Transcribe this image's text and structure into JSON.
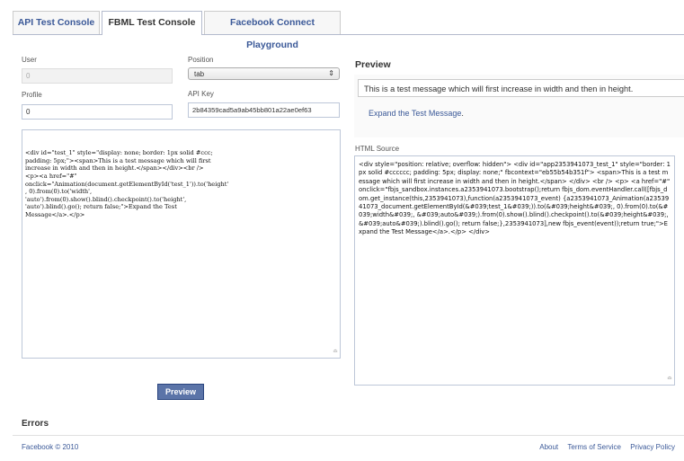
{
  "tabs": [
    {
      "label": "API Test Console"
    },
    {
      "label": "FBML Test Console"
    },
    {
      "label": "Facebook Connect Playground"
    }
  ],
  "form": {
    "user_label": "User",
    "user_value": "0",
    "position_label": "Position",
    "position_value": "tab",
    "profile_label": "Profile",
    "profile_value": "0",
    "api_key_label": "API Key",
    "api_key_value": "2b84359cad5a9ab45bb801a22ae0ef63"
  },
  "fbml_code": "<div id=\"test_1\" style=\"display: none; border: 1px solid #ccc;\npadding: 5px;\"><span>This is a test message which will first\nincrease in width and then in height.</span></div><br />\n<p><a href=\"#\"\nonclick=\"Animation(document.getElementById('test_1')).to('height'\n, 0).from(0).to('width',\n'auto').from(0).show().blind().checkpoint().to('height',\n'auto').blind().go(); return false;\">Expand the Test\nMessage</a>.</p>",
  "preview": {
    "title": "Preview",
    "message": "This is a test message which will first increase in width and then in height.",
    "link": "Expand the Test Message",
    "link_suffix": "."
  },
  "html_source": {
    "label": "HTML Source",
    "text": "<div style=\"position: relative; overflow: hidden\"> <div id=\"app2353941073_test_1\" style=\"border: 1px solid #cccccc; padding: 5px; display: none;\" fbcontext=\"eb55b54b351f\"> <span>This is a test message which will first increase in width and then in height.</span> </div> <br /> <p> <a href=\"#\" onclick=\"fbjs_sandbox.instances.a2353941073.bootstrap();return fbjs_dom.eventHandler.call([fbjs_dom.get_instance(this,2353941073),function(a2353941073_event) {a2353941073_Animation(a2353941073_document.getElementById(&#039;test_1&#039;)).to(&#039;height&#039;, 0).from(0).to(&#039;width&#039;, &#039;auto&#039;).from(0).show().blind().checkpoint().to(&#039;height&#039;, &#039;auto&#039;).blind().go(); return false;},2353941073],new fbjs_event(event));return true;\">Expand the Test Message</a>.</p> </div>"
  },
  "buttons": {
    "preview": "Preview"
  },
  "errors_label": "Errors",
  "footer": {
    "copyright": "Facebook © 2010",
    "links": [
      "About",
      "Terms of Service",
      "Privacy Policy"
    ]
  },
  "colors": {
    "link": "#3b5998",
    "button": "#5b74a8"
  }
}
